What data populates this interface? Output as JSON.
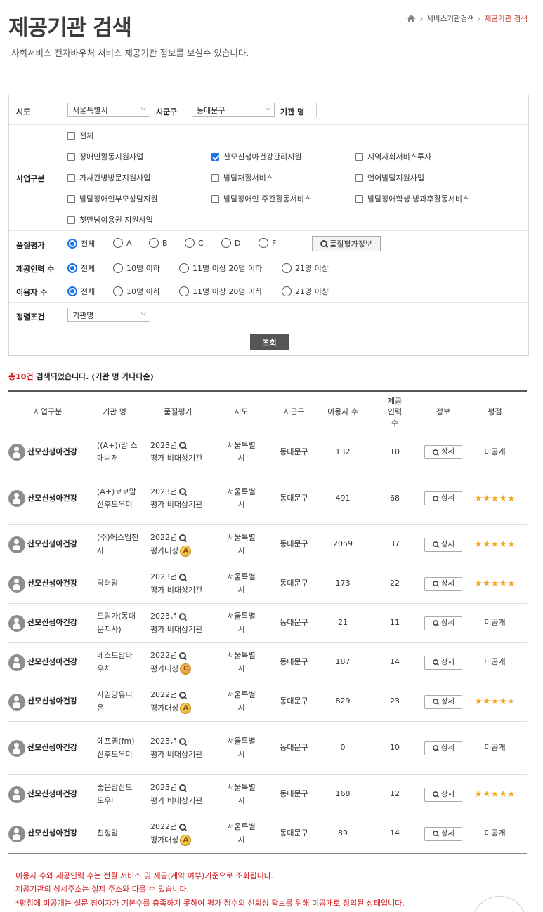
{
  "header": {
    "title": "제공기관 검색",
    "subtitle": "사회서비스 전자바우처 서비스 제공기관 정보를 보실수 있습니다.",
    "breadcrumb": [
      "서비스기관검색",
      "제공기관 검색"
    ]
  },
  "search": {
    "sido_label": "시도",
    "sido_value": "서울특별시",
    "sigungu_label": "시군구",
    "sigungu_value": "동대문구",
    "org_name_label": "기관 명",
    "org_name_value": "",
    "business_label": "사업구분",
    "business_items": [
      {
        "label": "전체",
        "checked": false
      },
      {
        "label": "장애인활동지원사업",
        "checked": false
      },
      {
        "label": "산모신생아건강관리지원",
        "checked": true
      },
      {
        "label": "지역사회서비스투자",
        "checked": false
      },
      {
        "label": "가사간병방문지원사업",
        "checked": false
      },
      {
        "label": "발달재활서비스",
        "checked": false
      },
      {
        "label": "언어발달지원사업",
        "checked": false
      },
      {
        "label": "발달장애인부모상담지원",
        "checked": false
      },
      {
        "label": "발달장애인 주간활동서비스",
        "checked": false
      },
      {
        "label": "발달장애학생 방과후활동서비스",
        "checked": false
      },
      {
        "label": "첫만남이용권 지원사업",
        "checked": false
      }
    ],
    "quality_label": "품질평가",
    "quality_options": [
      "전체",
      "A",
      "B",
      "C",
      "D",
      "F"
    ],
    "quality_button": "품질평가정보",
    "staff_label": "제공인력 수",
    "staff_options": [
      "전체",
      "10명 이하",
      "11명 이상 20명 이하",
      "21명 이상"
    ],
    "users_label": "이용자 수",
    "users_options": [
      "전체",
      "10명 이하",
      "11명 이상 20명 이하",
      "21명 이상"
    ],
    "sort_label": "정렬조건",
    "sort_value": "기관명",
    "submit_label": "조회"
  },
  "result": {
    "count_text": "총10건",
    "count_suffix": " 검색되었습니다. (기관 명 가나다순)"
  },
  "table": {
    "headers": [
      "사업구분",
      "기관 명",
      "품질평가",
      "시도",
      "시군구",
      "이용자 수",
      "제공 인력 수",
      "정보",
      "평점"
    ],
    "detail_label": "상세",
    "rows": [
      {
        "cat": "산모신생아건강",
        "name": "((A+))맘 스매니저",
        "year": "2023년",
        "eval": "평가 비대상기관",
        "grade": "",
        "sido": "서울특별시",
        "sigungu": "동대문구",
        "users": "132",
        "staff": "10",
        "rating": "미공개",
        "stars": 0
      },
      {
        "cat": "산모신생아건강",
        "name": "(A+)코코맘산후도우미",
        "year": "2023년",
        "eval": "평가 비대상기관",
        "grade": "",
        "sido": "서울특별시",
        "sigungu": "동대문구",
        "users": "491",
        "staff": "68",
        "rating": "",
        "stars": 5
      },
      {
        "cat": "산모신생아건강",
        "name": "(주)에스엠천사",
        "year": "2022년",
        "eval": "평가대상",
        "grade": "A",
        "sido": "서울특별시",
        "sigungu": "동대문구",
        "users": "2059",
        "staff": "37",
        "rating": "",
        "stars": 5
      },
      {
        "cat": "산모신생아건강",
        "name": "닥터맘",
        "year": "2023년",
        "eval": "평가 비대상기관",
        "grade": "",
        "sido": "서울특별시",
        "sigungu": "동대문구",
        "users": "173",
        "staff": "22",
        "rating": "",
        "stars": 5
      },
      {
        "cat": "산모신생아건강",
        "name": "드림가(동대문지사)",
        "year": "2023년",
        "eval": "평가 비대상기관",
        "grade": "",
        "sido": "서울특별시",
        "sigungu": "동대문구",
        "users": "21",
        "staff": "11",
        "rating": "미공개",
        "stars": 0
      },
      {
        "cat": "산모신생아건강",
        "name": "베스트맘바우처",
        "year": "2022년",
        "eval": "평가대상",
        "grade": "C",
        "sido": "서울특별시",
        "sigungu": "동대문구",
        "users": "187",
        "staff": "14",
        "rating": "미공개",
        "stars": 0
      },
      {
        "cat": "산모신생아건강",
        "name": "사임당유니온",
        "year": "2022년",
        "eval": "평가대상",
        "grade": "A",
        "sido": "서울특별시",
        "sigungu": "동대문구",
        "users": "829",
        "staff": "23",
        "rating": "",
        "stars": 4.5
      },
      {
        "cat": "산모신생아건강",
        "name": "에프엠(fm)산후도우미",
        "year": "2023년",
        "eval": "평가 비대상기관",
        "grade": "",
        "sido": "서울특별시",
        "sigungu": "동대문구",
        "users": "0",
        "staff": "10",
        "rating": "미공개",
        "stars": 0
      },
      {
        "cat": "산모신생아건강",
        "name": "좋은맘산모도우미",
        "year": "2023년",
        "eval": "평가 비대상기관",
        "grade": "",
        "sido": "서울특별시",
        "sigungu": "동대문구",
        "users": "168",
        "staff": "12",
        "rating": "",
        "stars": 5
      },
      {
        "cat": "산모신생아건강",
        "name": "친정맘",
        "year": "2022년",
        "eval": "평가대상",
        "grade": "A",
        "sido": "서울특별시",
        "sigungu": "동대문구",
        "users": "89",
        "staff": "14",
        "rating": "미공개",
        "stars": 0
      }
    ]
  },
  "notes": [
    "이용자 수와 제공인력 수는 전월 서비스 및 제공(계약 여부)기준으로 조회됩니다.",
    "제공기관의 상세주소는 실제 주소와 다를 수 있습니다.",
    "*평점에 미공개는 설문 참여자가 기본수를 충족하지 못하여 평가 점수의 신뢰성 확보를 위해 미공개로 정의된 상태입니다."
  ],
  "colors": {
    "accent": "#1a73e8",
    "alert": "#d0191c",
    "star": "#f5a623",
    "button_dark": "#555555"
  }
}
